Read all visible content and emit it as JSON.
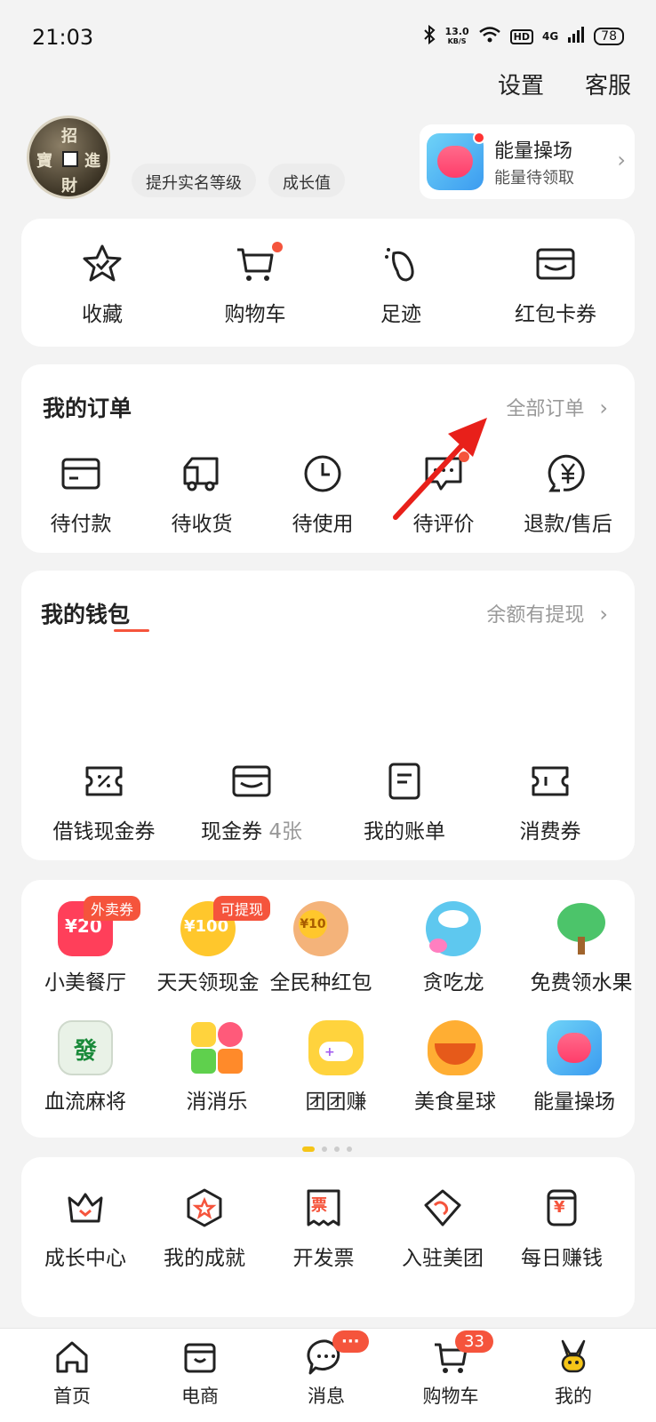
{
  "status": {
    "time": "21:03",
    "net_speed_value": "13.0",
    "net_speed_unit": "KB/S",
    "hd": "HD",
    "network": "4G",
    "battery": "78"
  },
  "top_nav": {
    "settings": "设置",
    "service": "客服"
  },
  "profile": {
    "avatar_chars": [
      "招",
      "進",
      "寶",
      "財"
    ],
    "chip_verify": "提升实名等级",
    "chip_growth": "成长值"
  },
  "energy_card": {
    "title": "能量操场",
    "subtitle": "能量待领取"
  },
  "quick": [
    {
      "label": "收藏"
    },
    {
      "label": "购物车"
    },
    {
      "label": "足迹"
    },
    {
      "label": "红包卡券"
    }
  ],
  "orders": {
    "title": "我的订单",
    "all_link": "全部订单",
    "items": [
      {
        "label": "待付款"
      },
      {
        "label": "待收货"
      },
      {
        "label": "待使用"
      },
      {
        "label": "待评价"
      },
      {
        "label": "退款/售后"
      }
    ]
  },
  "wallet": {
    "title": "我的钱包",
    "link": "余额有提现",
    "items": [
      {
        "label": "借钱现金券",
        "extra": ""
      },
      {
        "label": "现金券",
        "extra": "4张"
      },
      {
        "label": "我的账单",
        "extra": ""
      },
      {
        "label": "消费券",
        "extra": ""
      }
    ]
  },
  "apps": {
    "row1": [
      {
        "label": "小美餐厅",
        "tag": "外卖券",
        "glyph": "¥20",
        "color": "#ff3f5a"
      },
      {
        "label": "天天领现金",
        "tag": "可提现",
        "glyph": "¥100",
        "color": "#ffc72c"
      },
      {
        "label": "全民种红包",
        "tag": "",
        "glyph": "¥10",
        "color": "#f4b37a"
      },
      {
        "label": "贪吃龙",
        "tag": "",
        "glyph": "",
        "color": "#5ec8ef"
      },
      {
        "label": "免费领水果",
        "tag": "",
        "glyph": "",
        "color": "#4cc46a"
      }
    ],
    "row2": [
      {
        "label": "血流麻将",
        "glyph": "發",
        "color": "#e9f2e7"
      },
      {
        "label": "消消乐",
        "glyph": "",
        "color": "#ff6b5a"
      },
      {
        "label": "团团赚",
        "glyph": "",
        "color": "#ffd33d"
      },
      {
        "label": "美食星球",
        "glyph": "",
        "color": "#ffae33"
      },
      {
        "label": "能量操场",
        "glyph": "",
        "color": "#4fb7f5"
      }
    ]
  },
  "services": [
    {
      "label": "成长中心"
    },
    {
      "label": "我的成就"
    },
    {
      "label": "开发票",
      "glyph": "票"
    },
    {
      "label": "入驻美团"
    },
    {
      "label": "每日赚钱",
      "glyph": "¥"
    }
  ],
  "tabbar": [
    {
      "label": "首页"
    },
    {
      "label": "电商"
    },
    {
      "label": "消息",
      "badge": "···"
    },
    {
      "label": "购物车",
      "badge": "33"
    },
    {
      "label": "我的"
    }
  ],
  "colors": {
    "accent": "#f5543c",
    "brand_yellow": "#f5c518",
    "annotation_arrow": "#e8201a"
  }
}
